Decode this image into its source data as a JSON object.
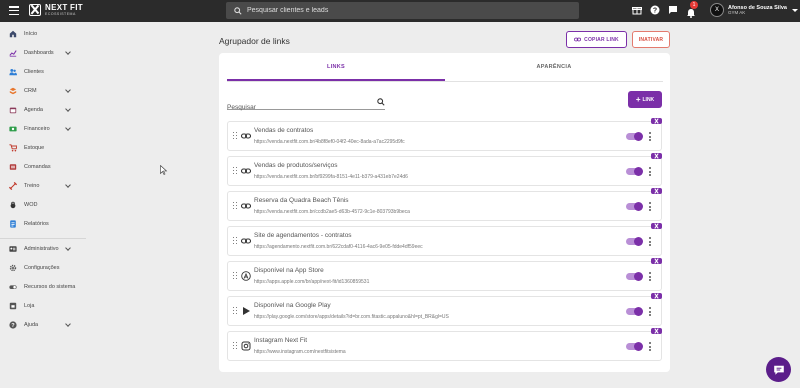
{
  "topbar": {
    "logo_name": "NEXT FIT",
    "logo_sub": "ECOSSISTEMA",
    "search_placeholder": "Pesquisar clientes e leads",
    "notification_count": "1",
    "user_initial": "X",
    "user_name": "Afonso de Souza Silva",
    "user_gym": "GYM AK"
  },
  "sidebar": {
    "items": [
      {
        "label": "Início",
        "icon": "home-icon"
      },
      {
        "label": "Dashboards",
        "icon": "chart-icon"
      },
      {
        "label": "Clientes",
        "icon": "people-icon"
      },
      {
        "label": "CRM",
        "icon": "crm-icon"
      },
      {
        "label": "Agenda",
        "icon": "calendar-icon"
      },
      {
        "label": "Financeiro",
        "icon": "money-icon"
      },
      {
        "label": "Estoque",
        "icon": "cart-icon"
      },
      {
        "label": "Comandas",
        "icon": "receipt-icon"
      },
      {
        "label": "Treino",
        "icon": "dumbbell-icon"
      },
      {
        "label": "WOD",
        "icon": "kettlebell-icon"
      },
      {
        "label": "Relatórios",
        "icon": "report-icon"
      },
      {
        "label": "Administrativo",
        "icon": "admin-icon"
      },
      {
        "label": "Configurações",
        "icon": "gear-icon"
      },
      {
        "label": "Recursos do sistema",
        "icon": "toggle-icon"
      },
      {
        "label": "Loja",
        "icon": "store-icon"
      },
      {
        "label": "Ajuda",
        "icon": "help-icon"
      }
    ]
  },
  "page": {
    "title": "Agrupador de links",
    "copy_link_label": "COPIAR LINK",
    "inactivate_label": "INATIVAR"
  },
  "card": {
    "tabs": [
      {
        "label": "LINKS",
        "active": true
      },
      {
        "label": "APARÊNCIA",
        "active": false
      }
    ],
    "search_placeholder": "Pesquisar",
    "add_link_label": "LINK",
    "links": [
      {
        "title": "Vendas de contratos",
        "url": "https://venda.nextfit.com.br/4b8f8ef0-04f2-40ec-8ada-a7ac2295d9fc",
        "icon": "link-icon",
        "enabled": true
      },
      {
        "title": "Vendas de produtos/serviços",
        "url": "https://venda.nextfit.com.br/bf9299fa-8151-4e11-b379-a431eb7e24d6",
        "icon": "link-icon",
        "enabled": true
      },
      {
        "title": "Reserva da Quadra Beach Tênis",
        "url": "https://venda.nextfit.com.br/ccdb2ae5-d63b-4572-9c1e-803793b9beca",
        "icon": "link-icon",
        "enabled": true
      },
      {
        "title": "Site de agendamentos - contratos",
        "url": "https://agendamento.nextfit.com.br/622cdaf0-4116-4ac6-9e05-fdde4df59eec",
        "icon": "link-icon",
        "enabled": true
      },
      {
        "title": "Disponível na App Store",
        "url": "https://apps.apple.com/br/app/next-fit/id1360859531",
        "icon": "app-store-icon",
        "enabled": true
      },
      {
        "title": "Disponível na Google Play",
        "url": "https://play.google.com/store/apps/details?id=br.com.fitastic.appaluno&hl=pt_BR&gl=US",
        "icon": "google-play-icon",
        "enabled": true
      },
      {
        "title": "Instagram Next Fit",
        "url": "https://www.instagram.com/nextfitsistema",
        "icon": "instagram-icon",
        "enabled": true
      }
    ]
  },
  "colors": {
    "accent": "#7b2fa8",
    "topbar": "#2b2b2b",
    "danger": "#d84c3e"
  }
}
